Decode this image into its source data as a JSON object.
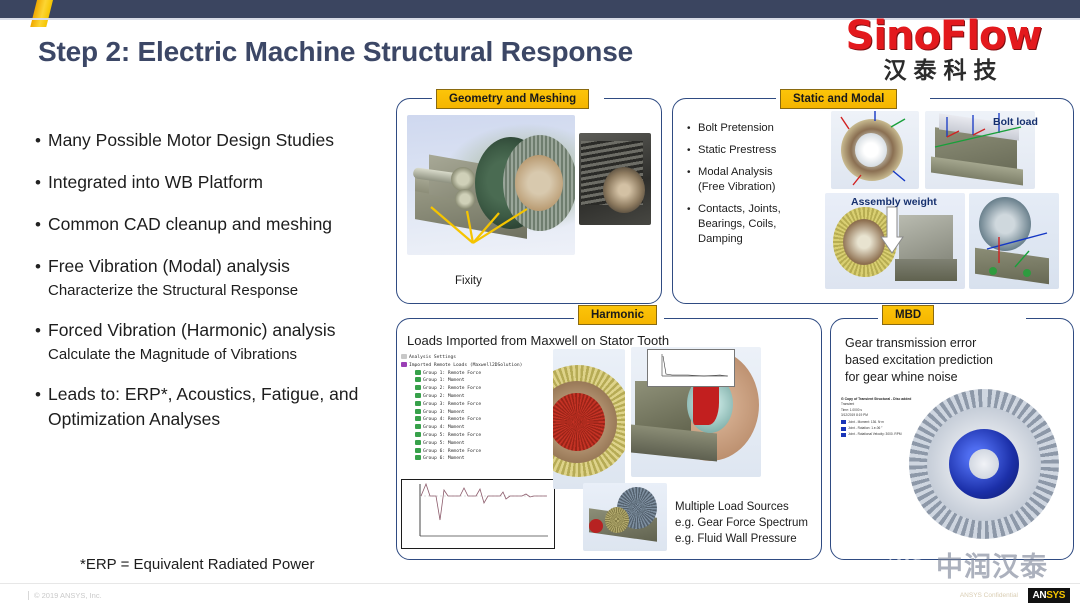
{
  "header": {
    "title": "Step 2:  Electric Machine Structural Response",
    "logo_main": "SinoFlow",
    "logo_cn": "汉泰科技"
  },
  "bullets": [
    {
      "main": "Many Possible Motor Design Studies",
      "sub": ""
    },
    {
      "main": "Integrated into WB Platform",
      "sub": ""
    },
    {
      "main": "Common CAD cleanup and meshing",
      "sub": ""
    },
    {
      "main": "Free Vibration (Modal) analysis",
      "sub": "Characterize the Structural Response"
    },
    {
      "main": "Forced Vibration (Harmonic) analysis",
      "sub": "Calculate the Magnitude of Vibrations"
    },
    {
      "main": "Leads to: ERP*, Acoustics, Fatigue, and Optimization Analyses",
      "sub": ""
    }
  ],
  "footnote": "*ERP = Equivalent Radiated Power",
  "bullet_marker": "•",
  "panels": {
    "geometry": {
      "badge": "Geometry and Meshing",
      "fixity_label": "Fixity"
    },
    "static_modal": {
      "badge": "Static and Modal",
      "items": [
        "Bolt Pretension",
        "Static Prestress",
        "Modal Analysis\n(Free Vibration)",
        "Contacts, Joints,\nBearings, Coils,\nDamping"
      ],
      "captions": {
        "bolt_load": "Bolt load",
        "assembly_weight": "Assembly weight"
      }
    },
    "harmonic": {
      "badge": "Harmonic",
      "title": "Loads Imported  from  Maxwell on Stator Tooth",
      "tree": [
        {
          "label": "Analysis Settings",
          "level": 0,
          "kind": "top"
        },
        {
          "label": "Imported Remote Loads (Maxwell2DSolution)",
          "level": 0,
          "kind": "root"
        },
        {
          "label": "Group 1: Remote Force",
          "level": 2,
          "kind": "leaf"
        },
        {
          "label": "Group 1: Moment",
          "level": 2,
          "kind": "leaf"
        },
        {
          "label": "Group 2: Remote Force",
          "level": 2,
          "kind": "leaf"
        },
        {
          "label": "Group 2: Moment",
          "level": 2,
          "kind": "leaf"
        },
        {
          "label": "Group 3: Remote Force",
          "level": 2,
          "kind": "leaf"
        },
        {
          "label": "Group 3: Moment",
          "level": 2,
          "kind": "leaf"
        },
        {
          "label": "Group 4: Remote Force",
          "level": 2,
          "kind": "leaf"
        },
        {
          "label": "Group 4: Moment",
          "level": 2,
          "kind": "leaf"
        },
        {
          "label": "Group 5: Remote Force",
          "level": 2,
          "kind": "leaf"
        },
        {
          "label": "Group 5: Moment",
          "level": 2,
          "kind": "leaf"
        },
        {
          "label": "Group 6: Remote Force",
          "level": 2,
          "kind": "leaf"
        },
        {
          "label": "Group 6: Moment",
          "level": 2,
          "kind": "leaf"
        }
      ],
      "multiple_loads": "Multiple Load Sources\ne.g. Gear Force Spectrum\ne.g. Fluid Wall Pressure"
    },
    "mbd": {
      "badge": "MBD",
      "text": "Gear transmission error\nbased excitation prediction\nfor gear whine noise"
    }
  },
  "watermark": {
    "icon": "wechat-icon",
    "text": "中润汉泰"
  },
  "footer": {
    "left": "© 2019 ANSYS, Inc.",
    "right": "ANSYS Confidential",
    "logo_a": "AN",
    "logo_b": "SYS"
  },
  "colors": {
    "navy_bar": "#3b4560",
    "accent_yellow": "#f5c400",
    "brand_red": "#e3191d",
    "panel_border": "#2f4b82",
    "title": "#3c4766"
  }
}
